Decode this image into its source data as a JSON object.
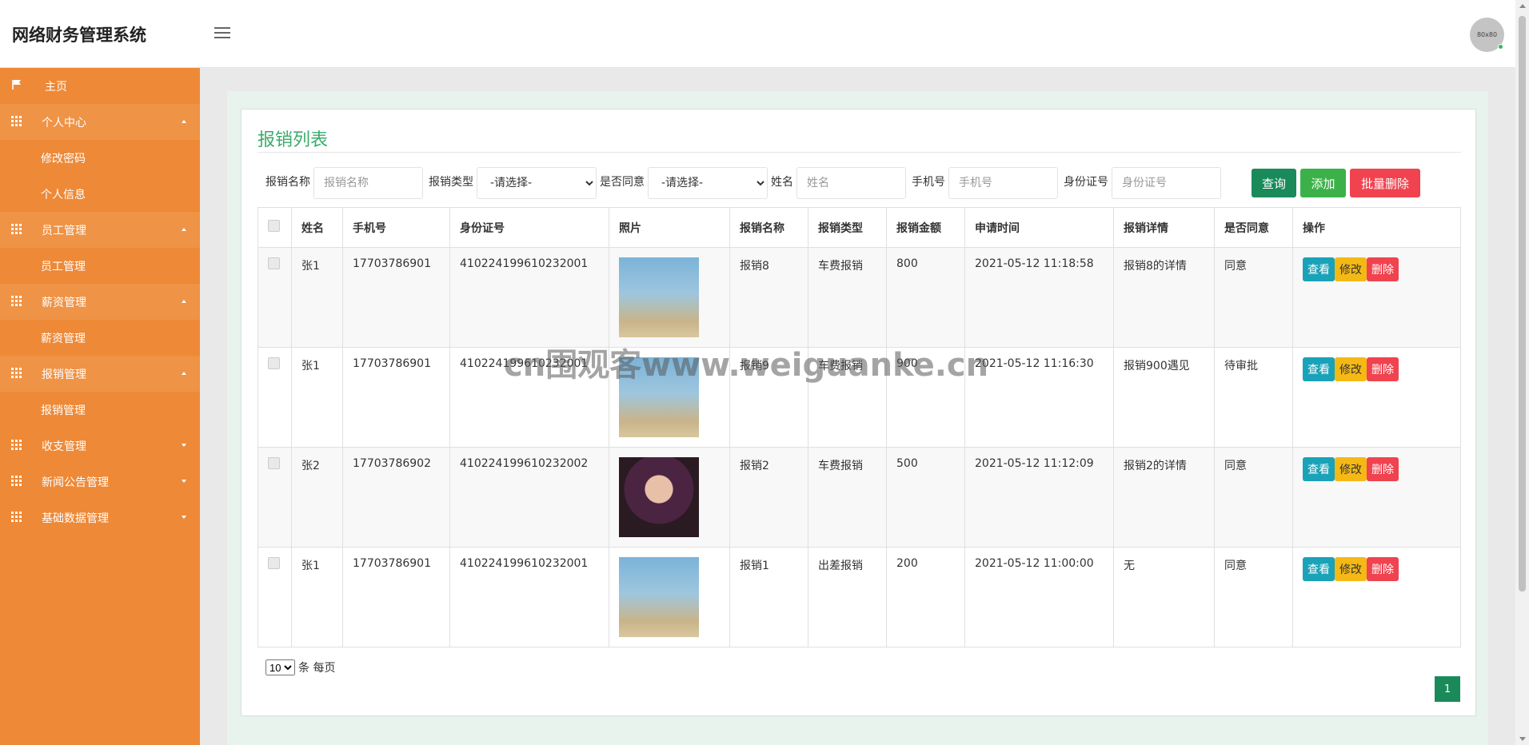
{
  "app": {
    "title": "网络财务管理系统",
    "avatar_text": "80x80"
  },
  "sidebar": {
    "items": [
      {
        "label": "主页",
        "icon": "flag-icon",
        "expanded": null,
        "children": []
      },
      {
        "label": "个人中心",
        "icon": "grid-icon",
        "expanded": true,
        "children": [
          "修改密码",
          "个人信息"
        ]
      },
      {
        "label": "员工管理",
        "icon": "grid-icon",
        "expanded": true,
        "children": [
          "员工管理"
        ]
      },
      {
        "label": "薪资管理",
        "icon": "grid-icon",
        "expanded": true,
        "children": [
          "薪资管理"
        ]
      },
      {
        "label": "报销管理",
        "icon": "grid-icon",
        "expanded": true,
        "children": [
          "报销管理"
        ]
      },
      {
        "label": "收支管理",
        "icon": "grid-icon",
        "expanded": false,
        "children": []
      },
      {
        "label": "新闻公告管理",
        "icon": "grid-icon",
        "expanded": false,
        "children": []
      },
      {
        "label": "基础数据管理",
        "icon": "grid-icon",
        "expanded": false,
        "children": []
      }
    ]
  },
  "main": {
    "title": "报销列表",
    "search": {
      "name_label": "报销名称",
      "name_placeholder": "报销名称",
      "type_label": "报销类型",
      "type_value": "-请选择-",
      "agree_label": "是否同意",
      "agree_value": "-请选择-",
      "person_label": "姓名",
      "person_placeholder": "姓名",
      "phone_label": "手机号",
      "phone_placeholder": "手机号",
      "id_label": "身份证号",
      "id_placeholder": "身份证号",
      "query_button": "查询",
      "add_button": "添加",
      "batch_delete_button": "批量删除"
    },
    "table": {
      "columns": [
        "姓名",
        "手机号",
        "身份证号",
        "照片",
        "报销名称",
        "报销类型",
        "报销金额",
        "申请时间",
        "报销详情",
        "是否同意",
        "操作"
      ],
      "rows": [
        {
          "name": "张1",
          "phone": "17703786901",
          "id_card": "410224199610232001",
          "photo": "person-photo-a",
          "title": "报销8",
          "type": "车费报销",
          "amount": "800",
          "time": "2021-05-12 11:18:58",
          "detail": "报销8的详情",
          "agree": "同意"
        },
        {
          "name": "张1",
          "phone": "17703786901",
          "id_card": "410224199610232001",
          "photo": "person-photo-a",
          "title": "报销9",
          "type": "车费报销",
          "amount": "900",
          "time": "2021-05-12 11:16:30",
          "detail": "报销900遇见",
          "agree": "待审批"
        },
        {
          "name": "张2",
          "phone": "17703786902",
          "id_card": "410224199610232002",
          "photo": "person-photo-b",
          "title": "报销2",
          "type": "车费报销",
          "amount": "500",
          "time": "2021-05-12 11:12:09",
          "detail": "报销2的详情",
          "agree": "同意"
        },
        {
          "name": "张1",
          "phone": "17703786901",
          "id_card": "410224199610232001",
          "photo": "person-photo-a",
          "title": "报销1",
          "type": "出差报销",
          "amount": "200",
          "time": "2021-05-12 11:00:00",
          "detail": "无",
          "agree": "同意"
        }
      ],
      "row_actions": {
        "view": "查看",
        "edit": "修改",
        "delete": "删除"
      }
    },
    "pagination": {
      "page_size": "10",
      "page_size_suffix": "条 每页",
      "current_page": "1"
    }
  },
  "watermark": "cn围观客www.weiguanke.cn",
  "colors": {
    "sidebar": "#ee8937",
    "accent_green": "#3bab6a",
    "query": "#1a8a5a",
    "add": "#3cb14a",
    "danger": "#f0434f",
    "view": "#1aa2b8",
    "edit": "#f5b916"
  }
}
